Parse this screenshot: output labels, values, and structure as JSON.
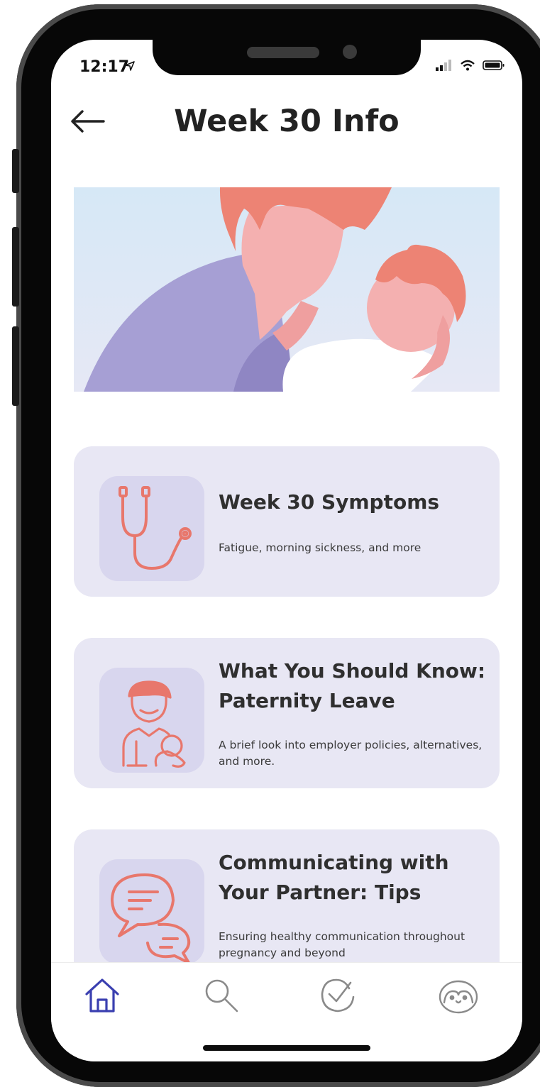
{
  "status_bar": {
    "time": "12:17"
  },
  "header": {
    "title": "Week 30 Info"
  },
  "cards": [
    {
      "title": "Week 30 Symptoms",
      "subtitle": "Fatigue, morning sickness, and more",
      "icon": "stethoscope-icon"
    },
    {
      "title": "What You Should Know: Paternity Leave",
      "subtitle": "A brief look into employer policies, alternatives, and more.",
      "icon": "parent-baby-icon"
    },
    {
      "title": "Communicating with Your Partner: Tips",
      "subtitle": "Ensuring healthy communication throughout pregnancy and beyond",
      "icon": "chat-bubbles-icon"
    }
  ],
  "tabbar": {
    "items": [
      {
        "name": "home",
        "icon": "home-icon",
        "active": true
      },
      {
        "name": "search",
        "icon": "search-icon",
        "active": false
      },
      {
        "name": "tasks",
        "icon": "check-circle-icon",
        "active": false
      },
      {
        "name": "profile",
        "icon": "penguin-icon",
        "active": false
      }
    ]
  },
  "colors": {
    "accent": "#e8776c",
    "active_tab": "#3a3fb0",
    "card_bg": "#e8e7f4",
    "icon_bg": "#d8d6ee"
  }
}
